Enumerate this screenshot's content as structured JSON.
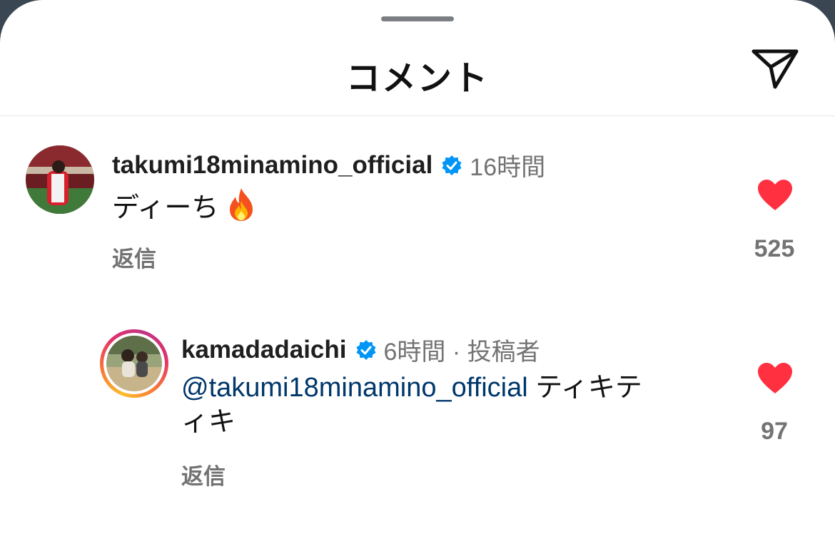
{
  "header": {
    "title": "コメント",
    "send_icon": "paper-plane-icon"
  },
  "comments": [
    {
      "username": "takumi18minamino_official",
      "verified": true,
      "time": "16時間",
      "text": "ディーち",
      "emoji": "fire-emoji",
      "reply_label": "返信",
      "likes": "525"
    },
    {
      "username": "kamadadaichi",
      "verified": true,
      "time": "6時間 · 投稿者",
      "mention": "@takumi18minamino_official",
      "text_line1": " ティキテ",
      "text_line2": "ィキ",
      "reply_label": "返信",
      "likes": "97"
    }
  ],
  "colors": {
    "heart": "#ff3040",
    "verified": "#0095f6",
    "mention": "#00376b",
    "muted": "#737373"
  }
}
